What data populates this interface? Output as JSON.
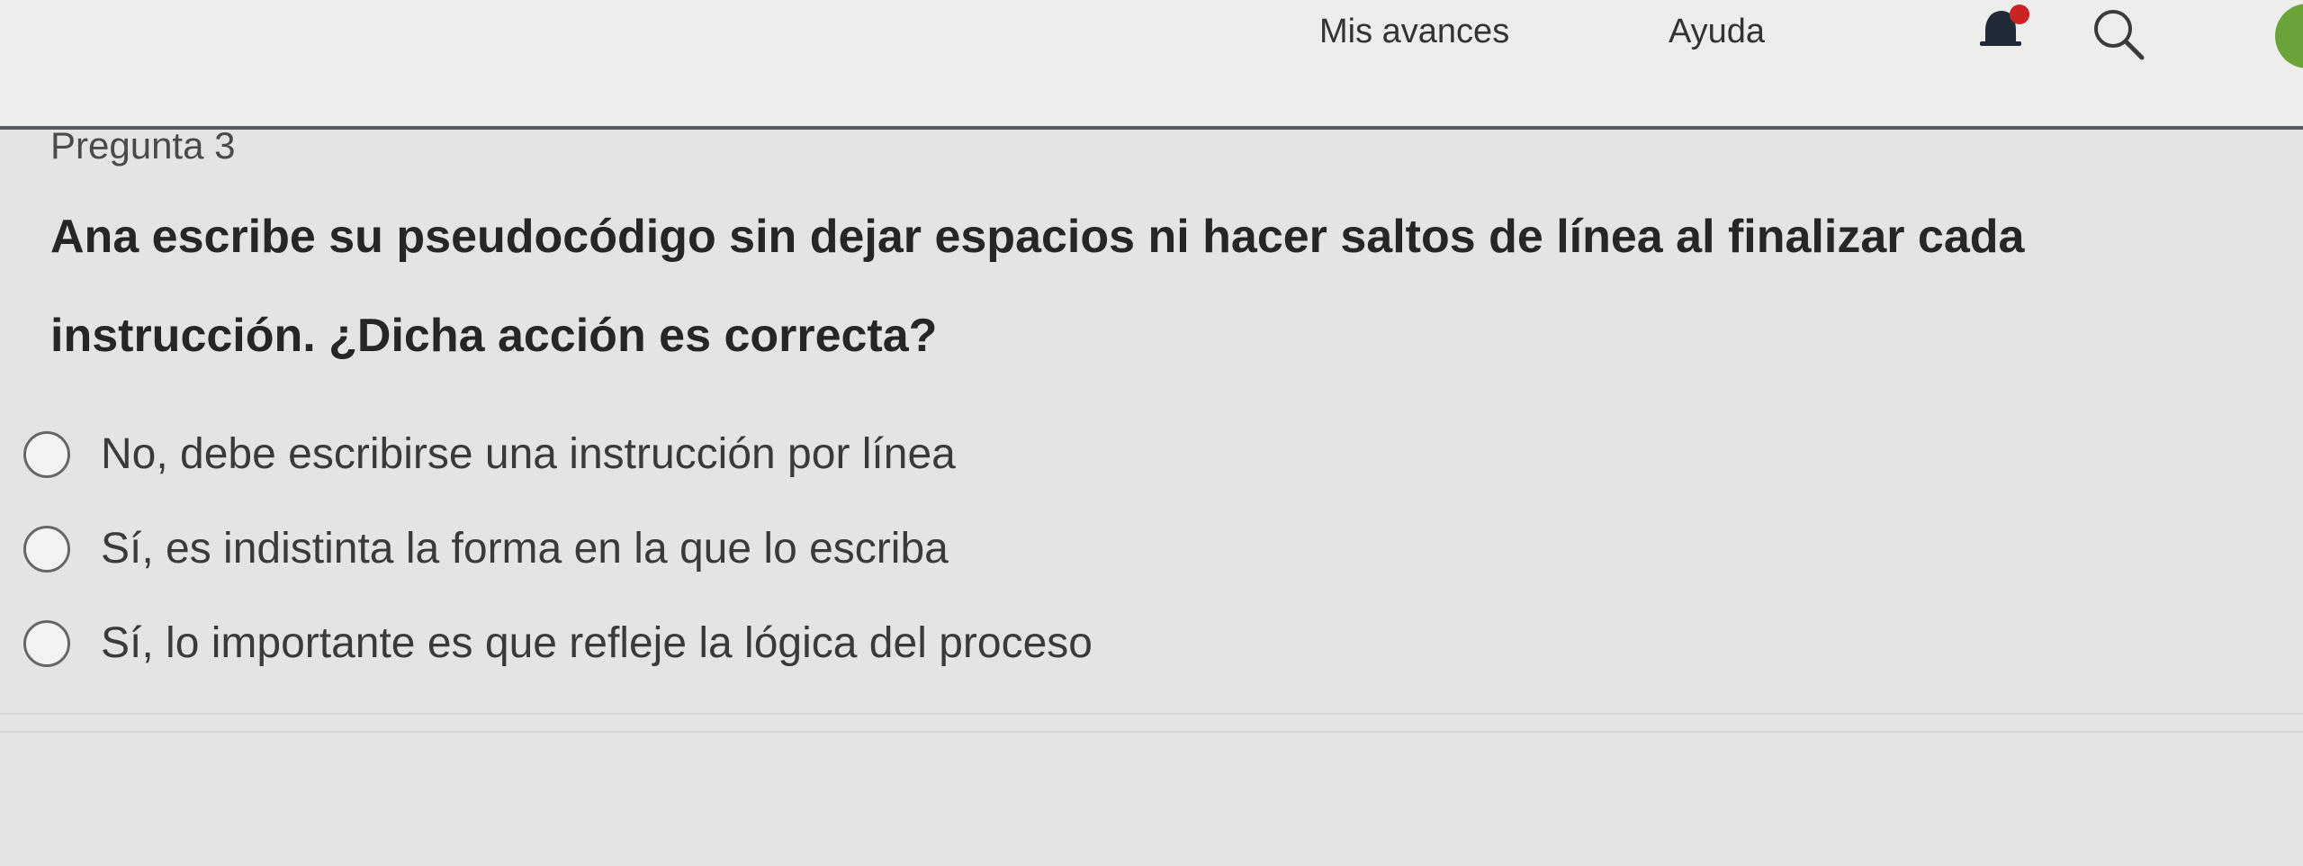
{
  "nav": {
    "progress_label": "Mis avances",
    "help_label": "Ayuda",
    "icons": [
      "bell-icon",
      "search-icon",
      "avatar"
    ],
    "avatar_color": "#6aa33a",
    "notification_badge_color": "#cc2222"
  },
  "question": {
    "number_label": "Pregunta 3",
    "text": "Ana escribe su pseudocódigo sin dejar espacios ni hacer saltos de línea al finalizar cada instrucción. ¿Dicha acción es correcta?",
    "options": [
      "No, debe escribirse una instrucción por línea",
      "Sí, es indistinta la forma en la que lo escriba",
      "Sí, lo importante es que refleje la lógica del proceso"
    ]
  }
}
